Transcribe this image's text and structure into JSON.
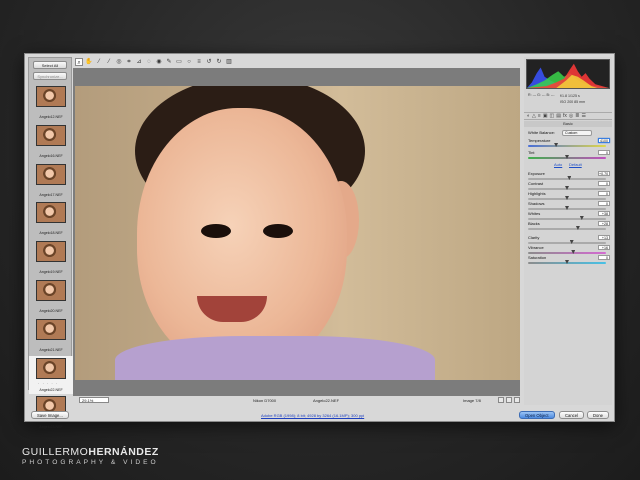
{
  "filmstrip": {
    "select_all": "Select All",
    "synchronize": "Synchronize...",
    "thumbnails": [
      {
        "caption": "Angelo12.NEF",
        "selected": false
      },
      {
        "caption": "Angelo16.NEF",
        "selected": false
      },
      {
        "caption": "Angelo17.NEF",
        "selected": false
      },
      {
        "caption": "Angelo18.NEF",
        "selected": false
      },
      {
        "caption": "Angelo19.NEF",
        "selected": false
      },
      {
        "caption": "Angelo20.NEF",
        "selected": false
      },
      {
        "caption": "Angelo21.NEF",
        "selected": false
      },
      {
        "caption": "Angelo22.NEF",
        "selected": true,
        "stars": "· · · · ·"
      },
      {
        "caption": "Angelo23.NEF",
        "selected": false
      }
    ]
  },
  "toolbar": {
    "tools": [
      {
        "name": "zoom-tool-icon",
        "glyph": "⌕",
        "active": true
      },
      {
        "name": "hand-tool-icon",
        "glyph": "✋"
      },
      {
        "name": "white-balance-tool-icon",
        "glyph": "⁄"
      },
      {
        "name": "color-sampler-tool-icon",
        "glyph": "⁄"
      },
      {
        "name": "targeted-adjustment-tool-icon",
        "glyph": "◎"
      },
      {
        "name": "crop-tool-icon",
        "glyph": "⌗"
      },
      {
        "name": "straighten-tool-icon",
        "glyph": "⊿"
      },
      {
        "name": "spot-removal-tool-icon",
        "glyph": "◌"
      },
      {
        "name": "red-eye-tool-icon",
        "glyph": "◉"
      },
      {
        "name": "adjustment-brush-icon",
        "glyph": "✎"
      },
      {
        "name": "graduated-filter-icon",
        "glyph": "▭"
      },
      {
        "name": "radial-filter-icon",
        "glyph": "○"
      },
      {
        "name": "preferences-icon",
        "glyph": "≡"
      },
      {
        "name": "rotate-left-icon",
        "glyph": "↺"
      },
      {
        "name": "rotate-right-icon",
        "glyph": "↻"
      },
      {
        "name": "trash-icon",
        "glyph": "▥"
      }
    ]
  },
  "preview": {
    "zoom": "29.1%",
    "camera": "Nikon D7000",
    "filename": "Angelo22.NEF",
    "counter": "Image 7/8"
  },
  "histogram": {
    "rgb": "R: ---  G: ---  B: ---",
    "exif_line1": "f/1.8   1/125 s",
    "exif_line2": "ISO 200   85 mm"
  },
  "panel": {
    "tab_icons": [
      "◐",
      "△",
      "≡",
      "▣",
      "◫",
      "▤",
      "fx",
      "◎",
      "≣",
      "☰"
    ],
    "title": "Basic",
    "white_balance_label": "White Balance:",
    "white_balance_value": "Custom",
    "temperature_label": "Temperature",
    "temperature_value": "4100",
    "tint_label": "Tint",
    "tint_value": "0",
    "auto_label": "Auto",
    "default_label": "Default",
    "exposure_label": "Exposure",
    "exposure_value": "+0.70",
    "contrast_label": "Contrast",
    "contrast_value": "0",
    "highlights_label": "Highlights",
    "highlights_value": "0",
    "shadows_label": "Shadows",
    "shadows_value": "0",
    "whites_label": "Whites",
    "whites_value": "+38",
    "blacks_label": "Blacks",
    "blacks_value": "+28",
    "clarity_label": "Clarity",
    "clarity_value": "+13",
    "vibrance_label": "Vibrance",
    "vibrance_value": "+16",
    "saturation_label": "Saturation",
    "saturation_value": "0",
    "slider_levels": {
      "temperature": 0.36,
      "tint": 0.5,
      "exposure": 0.53,
      "contrast": 0.5,
      "highlights": 0.5,
      "shadows": 0.5,
      "whites": 0.69,
      "blacks": 0.64,
      "clarity": 0.56,
      "vibrance": 0.58,
      "saturation": 0.5
    }
  },
  "bottom": {
    "save_image": "Save Image...",
    "workflow": "Adobe RGB (1998); 8 bit; 4928 by 3264 (16.1MP); 300 ppi",
    "open_object": "Open Object",
    "cancel": "Cancel",
    "done": "Done"
  },
  "watermark": {
    "name_light": "GUILLERMO",
    "name_bold": "HERNÁNDEZ",
    "tagline": "PHOTOGRAPHY & VIDEO"
  },
  "colors": {
    "primary_button": "#4d8be0",
    "link": "#1d4ec8"
  }
}
